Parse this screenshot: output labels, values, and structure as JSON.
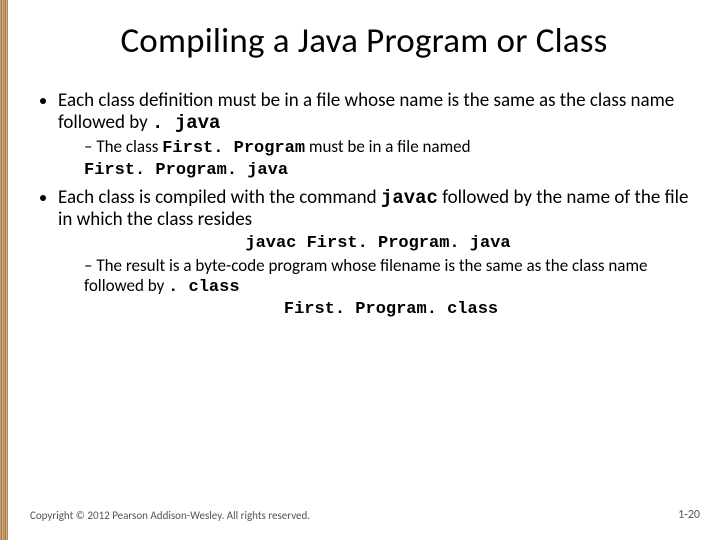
{
  "title": "Compiling a Java Program or Class",
  "bullets": {
    "b1a_pre": "Each class definition must be in a file whose name is the same as the class name followed by ",
    "b1a_code": ". java",
    "b1a_sub_pre": "The class ",
    "b1a_sub_code1": "First. Program",
    "b1a_sub_mid": " must be in a file named ",
    "b1a_sub_code2": "First. Program. java",
    "b1b_pre": "Each class is compiled with the command ",
    "b1b_code": "javac",
    "b1b_post": " followed by the name of the file in which the class resides",
    "center1": "javac First. Program. java",
    "b1b_sub_pre": "The result is a byte-code program whose filename is the same as the class name followed by ",
    "b1b_sub_code": ". class",
    "center2": "First. Program. class"
  },
  "footer": "Copyright © 2012 Pearson Addison-Wesley. All rights reserved.",
  "pagenum": "1-20"
}
